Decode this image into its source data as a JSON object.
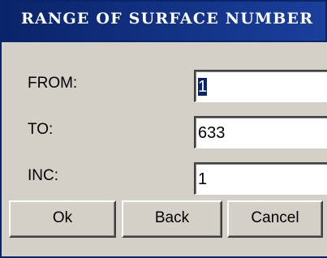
{
  "dialog": {
    "title": "RANGE OF SURFACE NUMBER"
  },
  "fields": {
    "from_label": "FROM:",
    "from_value": "1",
    "to_label": "TO:",
    "to_value": "633",
    "inc_label": "INC:",
    "inc_value": "1"
  },
  "buttons": {
    "ok": "Ok",
    "back": "Back",
    "cancel": "Cancel"
  },
  "colors": {
    "titlebar": "#0a246a",
    "dialog_bg": "#d4d0c8",
    "selection": "#0a246a"
  }
}
